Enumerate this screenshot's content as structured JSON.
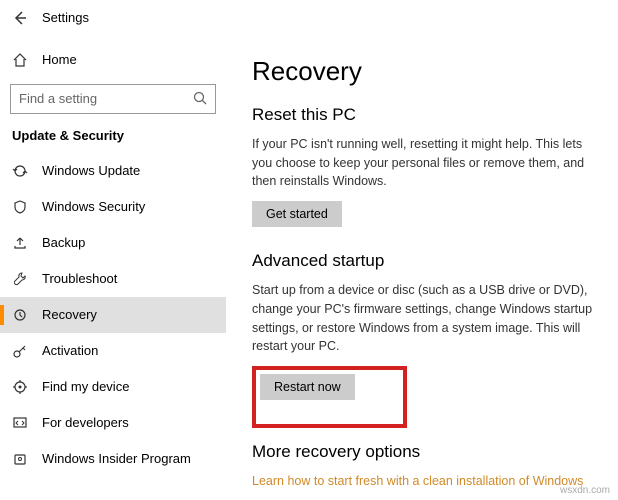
{
  "titlebar": {
    "title": "Settings"
  },
  "sidebar": {
    "home": "Home",
    "search_placeholder": "Find a setting",
    "section": "Update & Security",
    "items": [
      {
        "label": "Windows Update"
      },
      {
        "label": "Windows Security"
      },
      {
        "label": "Backup"
      },
      {
        "label": "Troubleshoot"
      },
      {
        "label": "Recovery"
      },
      {
        "label": "Activation"
      },
      {
        "label": "Find my device"
      },
      {
        "label": "For developers"
      },
      {
        "label": "Windows Insider Program"
      }
    ]
  },
  "main": {
    "heading": "Recovery",
    "reset": {
      "title": "Reset this PC",
      "desc": "If your PC isn't running well, resetting it might help. This lets you choose to keep your personal files or remove them, and then reinstalls Windows.",
      "button": "Get started"
    },
    "advanced": {
      "title": "Advanced startup",
      "desc": "Start up from a device or disc (such as a USB drive or DVD), change your PC's firmware settings, change Windows startup settings, or restore Windows from a system image. This will restart your PC.",
      "button": "Restart now"
    },
    "more": {
      "title": "More recovery options",
      "link": "Learn how to start fresh with a clean installation of Windows"
    }
  },
  "watermark": "wsxdn.com"
}
